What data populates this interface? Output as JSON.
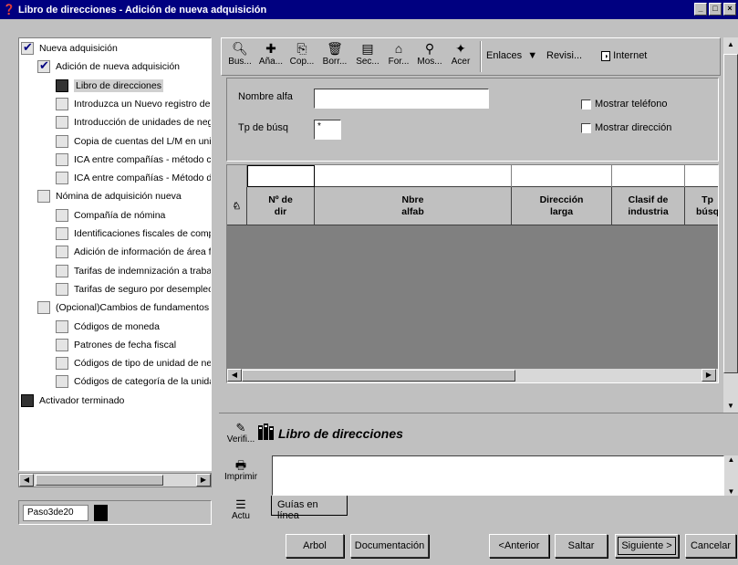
{
  "window": {
    "title": "Libro de direcciones - Adición de nueva adquisición"
  },
  "tree": {
    "items": [
      {
        "label": "Nueva adquisición",
        "level": 0,
        "state": "checked"
      },
      {
        "label": "Adición de nueva adquisición",
        "level": 1,
        "state": "checked"
      },
      {
        "label": "Libro de direcciones",
        "level": 2,
        "state": "dark",
        "selected": true
      },
      {
        "label": "Introduzca un Nuevo registro de la",
        "level": 2,
        "state": "empty"
      },
      {
        "label": "Introducción de unidades de negoc",
        "level": 2,
        "state": "empty"
      },
      {
        "label": "Copia de cuentas del L/M en unidad",
        "level": 2,
        "state": "empty"
      },
      {
        "label": "ICA entre compañías - método cent",
        "level": 2,
        "state": "empty"
      },
      {
        "label": "ICA entre compañías - Método deta",
        "level": 2,
        "state": "empty"
      },
      {
        "label": "Nómina de adquisición nueva",
        "level": 1,
        "state": "empty"
      },
      {
        "label": "Compañía de nómina",
        "level": 2,
        "state": "empty"
      },
      {
        "label": "Identificaciones fiscales de compañ",
        "level": 2,
        "state": "empty"
      },
      {
        "label": "Adición de información de área fisc",
        "level": 2,
        "state": "empty"
      },
      {
        "label": "Tarifas de indemnización a trabajac",
        "level": 2,
        "state": "empty"
      },
      {
        "label": "Tarifas de seguro por desempleo",
        "level": 2,
        "state": "empty"
      },
      {
        "label": "(Opcional)Cambios de fundamentos",
        "level": 1,
        "state": "empty"
      },
      {
        "label": "Códigos de moneda",
        "level": 2,
        "state": "empty"
      },
      {
        "label": "Patrones de fecha fiscal",
        "level": 2,
        "state": "empty"
      },
      {
        "label": "Códigos de tipo de unidad de negoc",
        "level": 2,
        "state": "empty"
      },
      {
        "label": "Códigos de categoría de la unidad c",
        "level": 2,
        "state": "empty"
      },
      {
        "label": "Activador terminado",
        "level": 0,
        "state": "dark"
      }
    ]
  },
  "step": {
    "label": "Paso3de20"
  },
  "toolbar": {
    "buttons": [
      {
        "label": "Bus...",
        "icon": "find-icon"
      },
      {
        "label": "Aña...",
        "icon": "add-icon"
      },
      {
        "label": "Cop...",
        "icon": "copy-icon"
      },
      {
        "label": "Borr...",
        "icon": "delete-icon"
      },
      {
        "label": "Sec...",
        "icon": "select-icon"
      },
      {
        "label": "For...",
        "icon": "form-icon"
      },
      {
        "label": "Mos...",
        "icon": "show-icon"
      },
      {
        "label": "Acer",
        "icon": "about-icon"
      }
    ],
    "links": {
      "enlaces": "Enlaces",
      "revisi": "Revisi...",
      "internet": "Internet"
    }
  },
  "form": {
    "nombre_alfa_label": "Nombre alfa",
    "nombre_alfa_value": "",
    "tp_busq_label": "Tp de búsq",
    "tp_busq_value": "*",
    "mostrar_telefono": "Mostrar teléfono",
    "mostrar_direccion": "Mostrar dirección"
  },
  "grid": {
    "columns": [
      {
        "line1": "Nº de",
        "line2": "dir"
      },
      {
        "line1": "Nbre",
        "line2": "alfab"
      },
      {
        "line1": "Dirección",
        "line2": "larga"
      },
      {
        "line1": "Clasif de",
        "line2": "industria"
      },
      {
        "line1": "Tp",
        "line2": "búsq"
      }
    ]
  },
  "guide": {
    "title": "Libro de direcciones",
    "tab": "Guías en línea",
    "verify": "Verifi...",
    "print": "Imprimir",
    "update": "Actu"
  },
  "buttons": {
    "arbol": "Arbol",
    "documentacion": "Documentación",
    "anterior": "<Anterior",
    "saltar": "Saltar",
    "siguiente": "Siguiente >",
    "cancelar": "Cancelar"
  }
}
